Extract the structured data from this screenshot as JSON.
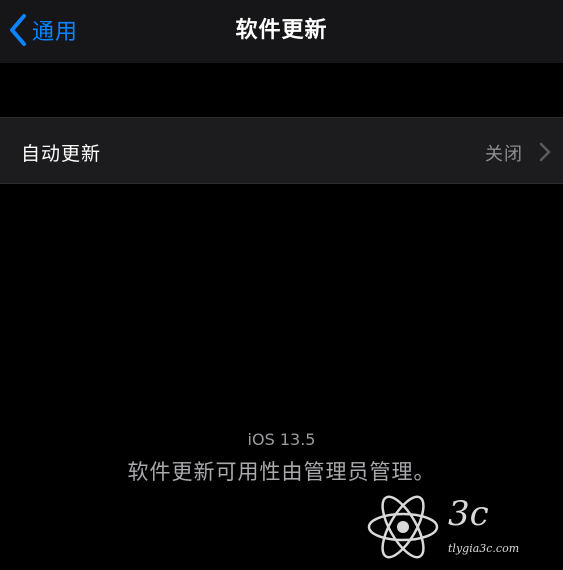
{
  "nav": {
    "back_label": "通用",
    "title": "软件更新"
  },
  "auto_update": {
    "label": "自动更新",
    "value": "关闭"
  },
  "info": {
    "version": "iOS 13.5",
    "note": "软件更新可用性由管理员管理。"
  },
  "watermark": {
    "text": "3c",
    "subtext": "tlygia3c.com"
  },
  "icons": {
    "back": "chevron-left-icon",
    "disclosure": "chevron-right-icon",
    "watermark_logo": "atom-logo-icon"
  },
  "colors": {
    "accent": "#0a84ff",
    "background": "#000000",
    "nav_background": "#161618",
    "cell_background": "#1c1c1e",
    "secondary_text": "#8e8e93"
  }
}
